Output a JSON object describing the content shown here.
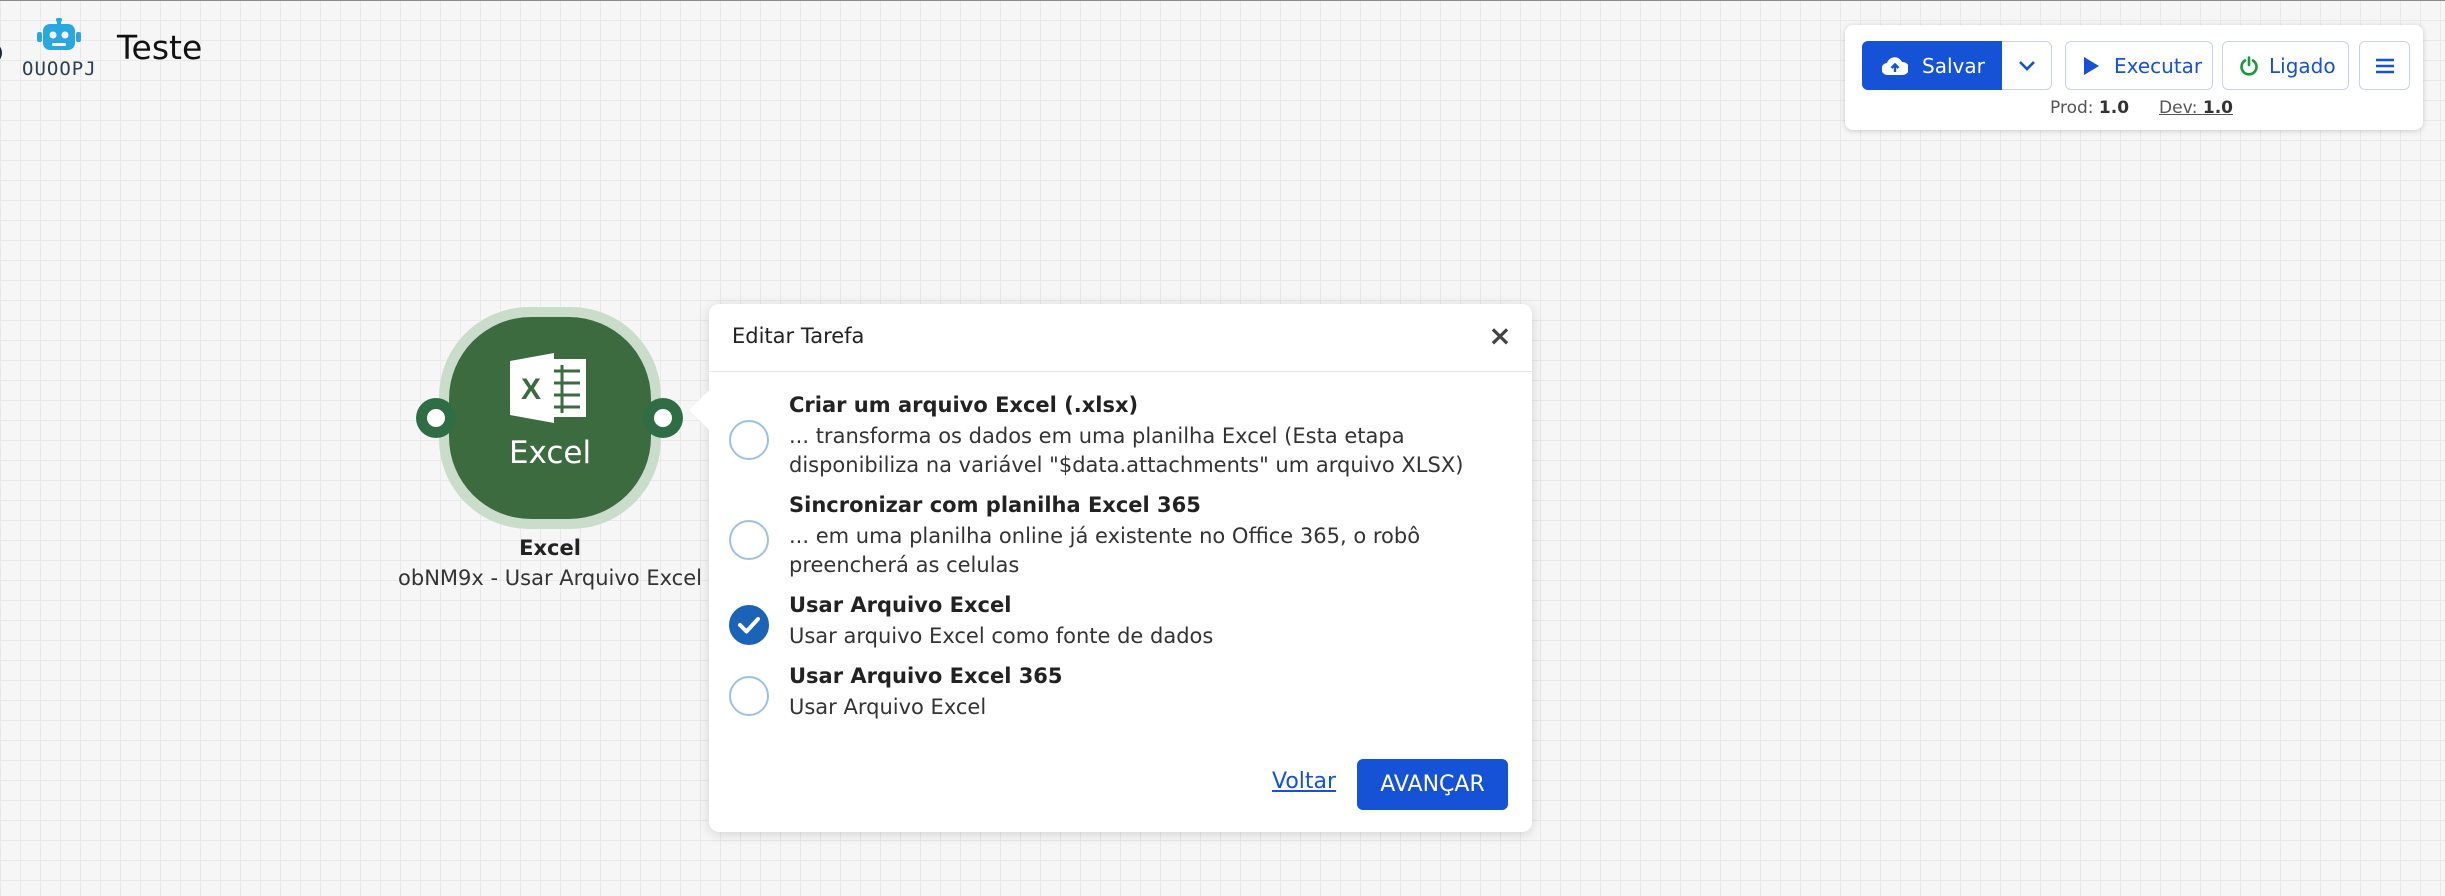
{
  "header": {
    "logo_text": "OUOOPJ",
    "project_title": "Teste",
    "robot_icon": "robot-icon"
  },
  "toolbar": {
    "save_label": "Salvar",
    "run_label": "Executar",
    "toggle_label": "Ligado",
    "prod_label": "Prod:",
    "prod_version": "1.0",
    "dev_label": "Dev:",
    "dev_version": "1.0",
    "accent_color": "#1552d6",
    "toggle_color": "#1a9a3a"
  },
  "node": {
    "icon_letter": "X",
    "label": "Excel",
    "name": "Excel",
    "subtitle": "obNM9x - Usar Arquivo Excel",
    "color": "#3d6b40"
  },
  "dialog": {
    "title": "Editar Tarefa",
    "close_symbol": "×",
    "options": [
      {
        "title": "Criar um arquivo Excel (.xlsx)",
        "description": "... transforma os dados em uma planilha Excel (Esta etapa disponibiliza na variável \"$data.attachments\" um arquivo XLSX)",
        "selected": false
      },
      {
        "title": "Sincronizar com planilha Excel 365",
        "description": "... em uma planilha online já existente no Office 365, o robô preencherá as celulas",
        "selected": false
      },
      {
        "title": "Usar Arquivo Excel",
        "description": "Usar arquivo Excel como fonte de dados",
        "selected": true
      },
      {
        "title": "Usar Arquivo Excel 365",
        "description": "Usar Arquivo Excel",
        "selected": false
      }
    ],
    "back_label": "Voltar",
    "next_label": "AVANÇAR"
  }
}
